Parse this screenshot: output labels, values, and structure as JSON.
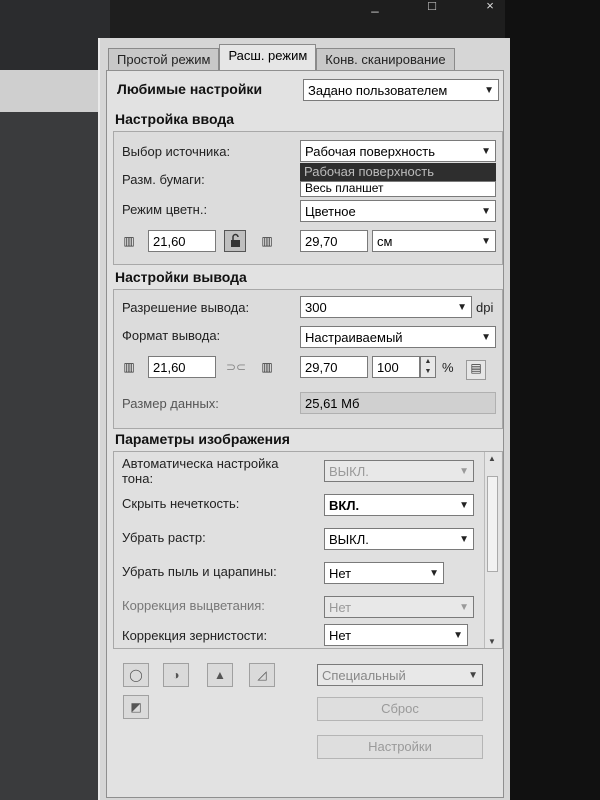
{
  "window": {
    "minimize": "_",
    "maximize": "□",
    "close": "×"
  },
  "tabs": [
    {
      "label": "Простой режим",
      "active": false
    },
    {
      "label": "Расш. режим",
      "active": true
    },
    {
      "label": "Конв. сканирование",
      "active": false
    }
  ],
  "favorites": {
    "label": "Любимые настройки",
    "value": "Задано пользователем"
  },
  "input": {
    "title": "Настройка ввода",
    "source_label": "Выбор источника:",
    "source_value": "Рабочая поверхность",
    "source_options": [
      "Рабочая поверхность",
      "Весь планшет"
    ],
    "paper_label": "Разм. бумаги:",
    "color_label": "Режим цветн.:",
    "color_value": "Цветное",
    "width": "21,60",
    "height": "29,70",
    "unit": "см"
  },
  "output": {
    "title": "Настройки вывода",
    "res_label": "Разрешение вывода:",
    "res_value": "300",
    "res_unit": "dpi",
    "format_label": "Формат вывода:",
    "format_value": "Настраиваемый",
    "width": "21,60",
    "height": "29,70",
    "scale": "100",
    "scale_unit": "%",
    "datasize_label": "Размер данных:",
    "datasize_value": "25,61 Мб"
  },
  "image": {
    "title": "Параметры изображения",
    "rows": [
      {
        "label": "Автоматическа настройка тона:",
        "value": "ВЫКЛ.",
        "enabled": false
      },
      {
        "label": "Скрыть нечеткость:",
        "value": "ВКЛ.",
        "enabled": true
      },
      {
        "label": "Убрать растр:",
        "value": "ВЫКЛ.",
        "enabled": true
      },
      {
        "label": "Убрать пыль и царапины:",
        "value": "Нет",
        "enabled": true
      },
      {
        "label": "Коррекция выцветания:",
        "value": "Нет",
        "enabled": false
      },
      {
        "label": "Коррекция зернистости:",
        "value": "Нет",
        "enabled": true
      }
    ]
  },
  "bottom": {
    "preset_value": "Специальный",
    "reset_label": "Сброс",
    "settings_label": "Настройки"
  }
}
